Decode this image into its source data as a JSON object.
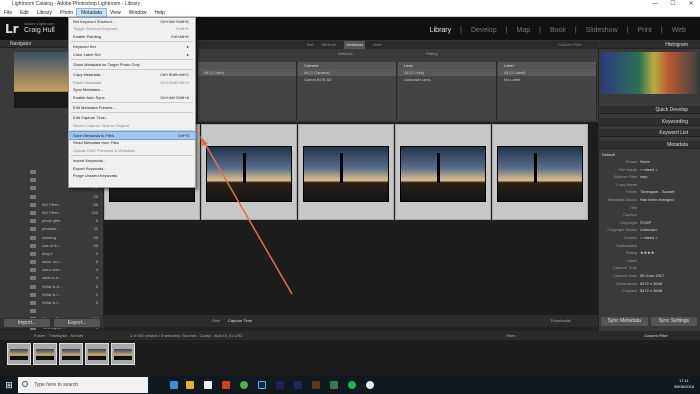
{
  "window": {
    "title": "Lightroom Catalog - Adobe Photoshop Lightroom - Library",
    "min": "—",
    "max": "☐",
    "close": "✕"
  },
  "menubar": [
    "File",
    "Edit",
    "Library",
    "Photo",
    "Metadata",
    "View",
    "Window",
    "Help"
  ],
  "identity": {
    "logo": "Lr",
    "catalog": "Adobe Lightroom",
    "user": "Craig Hull"
  },
  "modules": [
    "Library",
    "Develop",
    "Map",
    "Book",
    "Slideshow",
    "Print",
    "Web"
  ],
  "left": {
    "navigator": "Navigator",
    "fit": "FIT  FILL  1:1  1:4"
  },
  "folders": [
    {
      "name": "",
      "count": "5"
    },
    {
      "name": "",
      "count": "13"
    },
    {
      "name": "",
      "count": "82"
    },
    {
      "name": "",
      "count": "20"
    },
    {
      "name": "NO Filter...",
      "count": "66"
    },
    {
      "name": "NO Filter...",
      "count": "120"
    },
    {
      "name": "photo gifts",
      "count": "5"
    },
    {
      "name": "photosh...",
      "count": "11"
    },
    {
      "name": "relaxing",
      "count": "20"
    },
    {
      "name": "rule of th...",
      "count": "20"
    },
    {
      "name": "blog 1",
      "count": "3"
    },
    {
      "name": "stock vs r...",
      "count": "8"
    },
    {
      "name": "used vers...",
      "count": "4"
    },
    {
      "name": "what is a...",
      "count": "4"
    },
    {
      "name": "What is D...",
      "count": "5"
    },
    {
      "name": "What is I...",
      "count": "1"
    },
    {
      "name": "What is l...",
      "count": "3"
    },
    {
      "name": "",
      "count": ""
    },
    {
      "name": "Screen Photo...",
      "count": "100"
    },
    {
      "name": "Time-lapse...",
      "count": "1"
    },
    {
      "name": "Timelapse - Sun",
      "count": "400"
    },
    {
      "name": "Pictures",
      "count": "10"
    }
  ],
  "buttons": {
    "import": "Import...",
    "export": "Export...",
    "sync_metadata": "Sync Metadata",
    "sync_settings": "Sync Settings"
  },
  "filter": {
    "items": [
      "Text",
      "Attribute",
      "Metadata",
      "None"
    ],
    "preset": "Custom Filter"
  },
  "metarow": {
    "default": "Default",
    "attribute": "Attribute",
    "rating": "Rating",
    "text": "Text"
  },
  "columns": [
    {
      "header": "",
      "cells": [
        "All (1 Date)"
      ]
    },
    {
      "header": "Camera",
      "cells": [
        "All (1 Camera)",
        "Canon EOS 6D"
      ]
    },
    {
      "header": "Lens",
      "cells": [
        "All (1 Lens)",
        "Unknown Lens"
      ]
    },
    {
      "header": "Label",
      "cells": [
        "All (1 Label)",
        "No Label"
      ]
    }
  ],
  "metadata_menu": [
    {
      "label": "Set Keyword Shortcut...",
      "key": "Ctrl+Alt+Shift+K",
      "disabled": false
    },
    {
      "label": "Toggle Shortcut Keyword",
      "key": "Shift+K",
      "disabled": true
    },
    {
      "label": "Enable Painting",
      "key": "Ctrl+Alt+K",
      "disabled": false
    },
    {
      "sep": true
    },
    {
      "label": "Keyword Set",
      "key": "▸",
      "disabled": false
    },
    {
      "label": "Color Label Set",
      "key": "▸",
      "disabled": false
    },
    {
      "sep": true
    },
    {
      "label": "Show Metadata for Target Photo Only",
      "key": "",
      "disabled": false
    },
    {
      "sep": true
    },
    {
      "label": "Copy Metadata...",
      "key": "Ctrl+Shift+Alt+C",
      "disabled": false
    },
    {
      "label": "Paste Metadata",
      "key": "Ctrl+Shift+Alt+V",
      "disabled": true
    },
    {
      "label": "Sync Metadata...",
      "key": "",
      "disabled": false
    },
    {
      "label": "Enable Auto Sync",
      "key": "Ctrl+Alt+Shift+A",
      "disabled": false
    },
    {
      "sep": true
    },
    {
      "label": "Edit Metadata Presets...",
      "key": "",
      "disabled": false
    },
    {
      "sep": true
    },
    {
      "label": "Edit Capture Time...",
      "key": "",
      "disabled": false
    },
    {
      "label": "Revert Capture Time to Original",
      "key": "",
      "disabled": true
    },
    {
      "sep": true
    },
    {
      "label": "Save Metadata to Files",
      "key": "Ctrl+S",
      "disabled": false,
      "highlight": true
    },
    {
      "label": "Read Metadata from Files",
      "key": "",
      "disabled": false
    },
    {
      "label": "Update DNG Previews & Metadata",
      "key": "",
      "disabled": true
    },
    {
      "sep": true
    },
    {
      "label": "Import Keywords...",
      "key": "",
      "disabled": false
    },
    {
      "label": "Export Keywords...",
      "key": "",
      "disabled": false
    },
    {
      "label": "Purge Unused Keywords",
      "key": "",
      "disabled": false
    }
  ],
  "right": {
    "histogram": "Histogram",
    "quick_develop": "Quick Develop",
    "keywording": "Keywording",
    "keyword_list": "Keyword List",
    "metadata": "Metadata",
    "default_label": "Default",
    "meta_rows": [
      {
        "k": "Preset",
        "v": "None"
      },
      {
        "k": "File Name",
        "v": "< mixed >"
      },
      {
        "k": "Sidecar Files",
        "v": "xmp"
      },
      {
        "k": "Copy Name",
        "v": ""
      },
      {
        "k": "Folder",
        "v": "Timelapse - Sunset"
      },
      {
        "k": "Metadata Status",
        "v": "Has been changed"
      },
      {
        "k": "Title",
        "v": ""
      },
      {
        "k": "Caption",
        "v": ""
      },
      {
        "k": "Copyright",
        "v": "©CKP"
      },
      {
        "k": "Copyright Status",
        "v": "Unknown"
      },
      {
        "k": "Creator",
        "v": "< mixed >"
      },
      {
        "k": "Sublocation",
        "v": ""
      },
      {
        "k": "Rating",
        "v": "★★★★·"
      },
      {
        "k": "Label",
        "v": ""
      },
      {
        "k": "Capture Time",
        "v": ""
      },
      {
        "k": "Capture Date",
        "v": "05 June 2017"
      },
      {
        "k": "Dimensions",
        "v": "5472 x 3648"
      },
      {
        "k": "Cropped",
        "v": "5472 x 3648"
      }
    ]
  },
  "toolbar": {
    "sort": "Sort:",
    "sort_value": "Capture Time",
    "thumbnails": "Thumbnails"
  },
  "filmstrip": {
    "path": "Folder : Timelapse - Sunset",
    "status": "1 of 400 photos / 5 selected / Sunrise - Cooky - 8L8 e2_61.CR2",
    "filter": "Filter :",
    "custom": "Custom Filter"
  },
  "taskbar": {
    "search": "Type here to search",
    "time": "17:11",
    "date": "05/06/2018"
  }
}
